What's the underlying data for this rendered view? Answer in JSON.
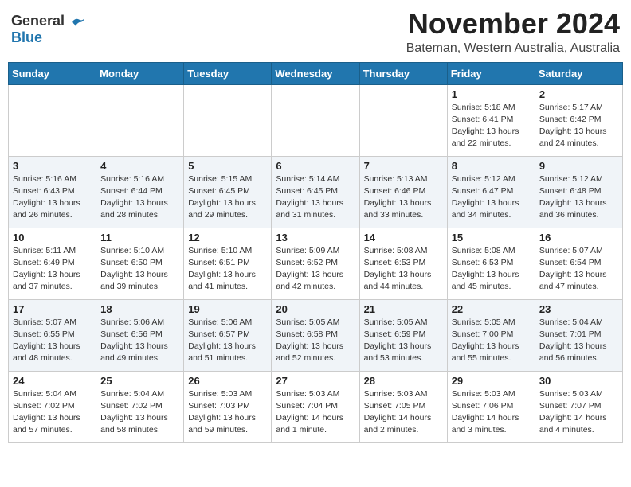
{
  "header": {
    "logo_general": "General",
    "logo_blue": "Blue",
    "month": "November 2024",
    "location": "Bateman, Western Australia, Australia"
  },
  "days_of_week": [
    "Sunday",
    "Monday",
    "Tuesday",
    "Wednesday",
    "Thursday",
    "Friday",
    "Saturday"
  ],
  "weeks": [
    [
      {
        "day": "",
        "info": ""
      },
      {
        "day": "",
        "info": ""
      },
      {
        "day": "",
        "info": ""
      },
      {
        "day": "",
        "info": ""
      },
      {
        "day": "",
        "info": ""
      },
      {
        "day": "1",
        "info": "Sunrise: 5:18 AM\nSunset: 6:41 PM\nDaylight: 13 hours\nand 22 minutes."
      },
      {
        "day": "2",
        "info": "Sunrise: 5:17 AM\nSunset: 6:42 PM\nDaylight: 13 hours\nand 24 minutes."
      }
    ],
    [
      {
        "day": "3",
        "info": "Sunrise: 5:16 AM\nSunset: 6:43 PM\nDaylight: 13 hours\nand 26 minutes."
      },
      {
        "day": "4",
        "info": "Sunrise: 5:16 AM\nSunset: 6:44 PM\nDaylight: 13 hours\nand 28 minutes."
      },
      {
        "day": "5",
        "info": "Sunrise: 5:15 AM\nSunset: 6:45 PM\nDaylight: 13 hours\nand 29 minutes."
      },
      {
        "day": "6",
        "info": "Sunrise: 5:14 AM\nSunset: 6:45 PM\nDaylight: 13 hours\nand 31 minutes."
      },
      {
        "day": "7",
        "info": "Sunrise: 5:13 AM\nSunset: 6:46 PM\nDaylight: 13 hours\nand 33 minutes."
      },
      {
        "day": "8",
        "info": "Sunrise: 5:12 AM\nSunset: 6:47 PM\nDaylight: 13 hours\nand 34 minutes."
      },
      {
        "day": "9",
        "info": "Sunrise: 5:12 AM\nSunset: 6:48 PM\nDaylight: 13 hours\nand 36 minutes."
      }
    ],
    [
      {
        "day": "10",
        "info": "Sunrise: 5:11 AM\nSunset: 6:49 PM\nDaylight: 13 hours\nand 37 minutes."
      },
      {
        "day": "11",
        "info": "Sunrise: 5:10 AM\nSunset: 6:50 PM\nDaylight: 13 hours\nand 39 minutes."
      },
      {
        "day": "12",
        "info": "Sunrise: 5:10 AM\nSunset: 6:51 PM\nDaylight: 13 hours\nand 41 minutes."
      },
      {
        "day": "13",
        "info": "Sunrise: 5:09 AM\nSunset: 6:52 PM\nDaylight: 13 hours\nand 42 minutes."
      },
      {
        "day": "14",
        "info": "Sunrise: 5:08 AM\nSunset: 6:53 PM\nDaylight: 13 hours\nand 44 minutes."
      },
      {
        "day": "15",
        "info": "Sunrise: 5:08 AM\nSunset: 6:53 PM\nDaylight: 13 hours\nand 45 minutes."
      },
      {
        "day": "16",
        "info": "Sunrise: 5:07 AM\nSunset: 6:54 PM\nDaylight: 13 hours\nand 47 minutes."
      }
    ],
    [
      {
        "day": "17",
        "info": "Sunrise: 5:07 AM\nSunset: 6:55 PM\nDaylight: 13 hours\nand 48 minutes."
      },
      {
        "day": "18",
        "info": "Sunrise: 5:06 AM\nSunset: 6:56 PM\nDaylight: 13 hours\nand 49 minutes."
      },
      {
        "day": "19",
        "info": "Sunrise: 5:06 AM\nSunset: 6:57 PM\nDaylight: 13 hours\nand 51 minutes."
      },
      {
        "day": "20",
        "info": "Sunrise: 5:05 AM\nSunset: 6:58 PM\nDaylight: 13 hours\nand 52 minutes."
      },
      {
        "day": "21",
        "info": "Sunrise: 5:05 AM\nSunset: 6:59 PM\nDaylight: 13 hours\nand 53 minutes."
      },
      {
        "day": "22",
        "info": "Sunrise: 5:05 AM\nSunset: 7:00 PM\nDaylight: 13 hours\nand 55 minutes."
      },
      {
        "day": "23",
        "info": "Sunrise: 5:04 AM\nSunset: 7:01 PM\nDaylight: 13 hours\nand 56 minutes."
      }
    ],
    [
      {
        "day": "24",
        "info": "Sunrise: 5:04 AM\nSunset: 7:02 PM\nDaylight: 13 hours\nand 57 minutes."
      },
      {
        "day": "25",
        "info": "Sunrise: 5:04 AM\nSunset: 7:02 PM\nDaylight: 13 hours\nand 58 minutes."
      },
      {
        "day": "26",
        "info": "Sunrise: 5:03 AM\nSunset: 7:03 PM\nDaylight: 13 hours\nand 59 minutes."
      },
      {
        "day": "27",
        "info": "Sunrise: 5:03 AM\nSunset: 7:04 PM\nDaylight: 14 hours\nand 1 minute."
      },
      {
        "day": "28",
        "info": "Sunrise: 5:03 AM\nSunset: 7:05 PM\nDaylight: 14 hours\nand 2 minutes."
      },
      {
        "day": "29",
        "info": "Sunrise: 5:03 AM\nSunset: 7:06 PM\nDaylight: 14 hours\nand 3 minutes."
      },
      {
        "day": "30",
        "info": "Sunrise: 5:03 AM\nSunset: 7:07 PM\nDaylight: 14 hours\nand 4 minutes."
      }
    ]
  ]
}
